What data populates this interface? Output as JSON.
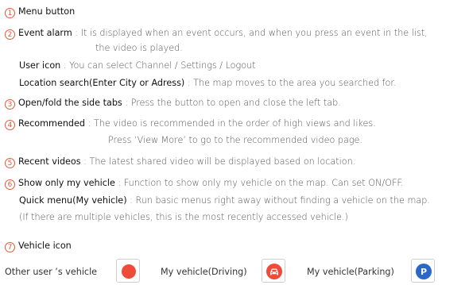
{
  "items": [
    {
      "num": "1",
      "term": "Menu button",
      "desc": ""
    },
    {
      "num": "2",
      "term": "Event alarm",
      "sep": " : ",
      "desc": "It is displayed when an event occurs, and when you press an event in the list,",
      "cont": "the video is played."
    },
    {
      "term": "User icon",
      "sep": " : ",
      "desc": "You can select Channel / Settings / Logout"
    },
    {
      "term": "Location search(Enter City or Adress)",
      "sep": " : ",
      "desc": "The map moves to the area you searched for."
    },
    {
      "num": "3",
      "term": "Open/fold the side tabs",
      "sep": " : ",
      "desc": "Press the button to open and close the left tab."
    },
    {
      "num": "4",
      "term": "Recommended",
      "sep": " : ",
      "desc": "The video is recommended in the order of high views and likes.",
      "cont": "Press ‘View More’ to go to the recommended video page."
    },
    {
      "num": "5",
      "term": "Recent videos",
      "sep": " : ",
      "desc": "The latest shared video will be displayed based on location."
    },
    {
      "num": "6",
      "term": "Show only my vehicle",
      "sep": " : ",
      "desc": "Function to show only my vehicle on the map. Can set ON/OFF."
    },
    {
      "term": "Quick menu(My vehicle)",
      "sep": " : ",
      "desc": "Run basic menus right away without finding a vehicle on the map.",
      "cont": "(If there are multiple vehicles, this is the most recently accessed vehicle.)"
    },
    {
      "num": "7",
      "term": "Vehicle icon",
      "desc": ""
    }
  ],
  "vehicles": [
    {
      "label": "Other user ’s vehicle",
      "icon": "red-dot-icon",
      "color": "#f04a38"
    },
    {
      "label": "My vehicle(Driving)",
      "icon": "car-icon",
      "color": "#f04a38",
      "glyph": "🚗"
    },
    {
      "label": "My vehicle(Parking)",
      "icon": "parking-icon",
      "color": "#2a67c9",
      "glyph": "P"
    }
  ]
}
